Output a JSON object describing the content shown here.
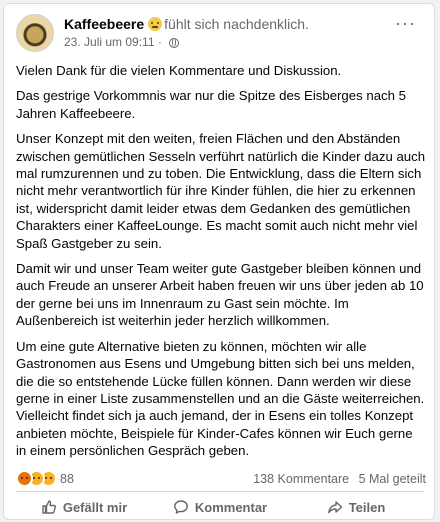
{
  "post": {
    "page_name": "Kaffeebeere",
    "feeling_icon": "thinking-face-emoji",
    "feeling_text": "fühlt sich nachdenklich.",
    "timestamp": "23. Juli um 09:11",
    "separator": "·",
    "audience_icon": "globe-icon",
    "more_label": "···"
  },
  "body": {
    "paragraphs": [
      "Vielen Dank für die vielen Kommentare und Diskussion.",
      "Das gestrige Vorkommnis war nur die Spitze des Eisberges nach 5 Jahren Kaffeebeere.",
      "Unser Konzept mit den weiten, freien Flächen und den Abständen zwischen gemütlichen Sesseln verführt natürlich die Kinder dazu auch mal rumzurennen und zu toben. Die Entwicklung, dass die Eltern sich nicht mehr verantwortlich für ihre Kinder fühlen, die hier zu erkennen ist, widerspricht damit leider etwas dem Gedanken des gemütlichen Charakters einer KaffeeLounge. Es macht somit auch nicht mehr viel Spaß Gastgeber zu sein.",
      "Damit wir und unser Team weiter gute Gastgeber bleiben können und auch Freude an unserer Arbeit haben freuen wir uns über jeden ab 10 der gerne bei uns im Innenraum zu Gast sein möchte. Im Außenbereich ist weiterhin jeder herzlich willkommen.",
      "Um eine gute Alternative bieten zu können, möchten wir alle Gastronomen aus Esens und Umgebung bitten sich bei uns melden, die die so entstehende Lücke füllen können. Dann werden wir diese gerne in einer Liste zusammenstellen und an die Gäste weiterreichen. Vielleicht findet sich ja auch jemand, der in Esens ein tolles Konzept anbieten möchte, Beispiele für Kinder-Cafes können wir Euch gerne in einem persönlichen Gespräch geben."
    ]
  },
  "stats": {
    "reactions": [
      "angry",
      "care",
      "sad"
    ],
    "reaction_count": "88",
    "comments": "138 Kommentare",
    "shares": "5 Mal geteilt"
  },
  "actions": {
    "like": "Gefällt mir",
    "comment": "Kommentar",
    "share": "Teilen"
  },
  "colors": {
    "secondary_text": "#65676b",
    "primary_text": "#050505",
    "angry": "#e9710f",
    "care_sad": "#f7b125"
  }
}
